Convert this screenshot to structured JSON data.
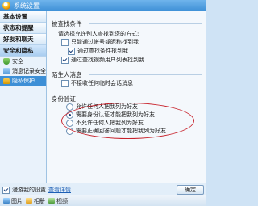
{
  "window": {
    "title": "系统设置"
  },
  "sidebar": {
    "items": [
      {
        "label": "基本设置"
      },
      {
        "label": "状态和提醒"
      },
      {
        "label": "好友和聊天"
      },
      {
        "label": "安全和隐私"
      }
    ],
    "subitems": [
      {
        "label": "安全",
        "icon": "shield-icon"
      },
      {
        "label": "消息记录安全",
        "icon": "message-icon"
      },
      {
        "label": "隐私保护",
        "icon": "lock-icon"
      }
    ]
  },
  "main": {
    "search_section": {
      "title": "被查找条件",
      "description": "请选择允许别人查找到您的方式:",
      "options": [
        {
          "label": "只能通过帐号或昵称找到我",
          "checked": false
        },
        {
          "label": "通过查找条件找到我",
          "checked": true
        },
        {
          "label": "通过查找视频用户列表找到我",
          "checked": true
        }
      ]
    },
    "stranger_section": {
      "title": "陌生人消息",
      "options": [
        {
          "label": "不接收任何临时会话消息",
          "checked": false
        }
      ]
    },
    "auth_section": {
      "title": "身份验证",
      "options": [
        {
          "label": "允许任何人把我列为好友",
          "checked": false
        },
        {
          "label": "需要身份认证才能把我列为好友",
          "checked": true
        },
        {
          "label": "不允许任何人把我列为好友",
          "checked": false
        },
        {
          "label": "需要正确回答问题才能把我列为好友",
          "checked": false
        }
      ]
    }
  },
  "footer": {
    "roaming_label": "漫游我的设置",
    "details_link": "查看详情",
    "roaming_checked": true,
    "ok_label": "确定"
  },
  "taskbar": {
    "items": [
      {
        "label": "图片",
        "icon": "picture-icon"
      },
      {
        "label": "相册",
        "icon": "album-icon"
      },
      {
        "label": "视频",
        "icon": "video-icon"
      }
    ]
  },
  "colors": {
    "title_bar": "#3d8fd6",
    "selected_item": "#3d8fd6",
    "highlight_ellipse": "#c8232c",
    "link": "#1d5fb5"
  }
}
